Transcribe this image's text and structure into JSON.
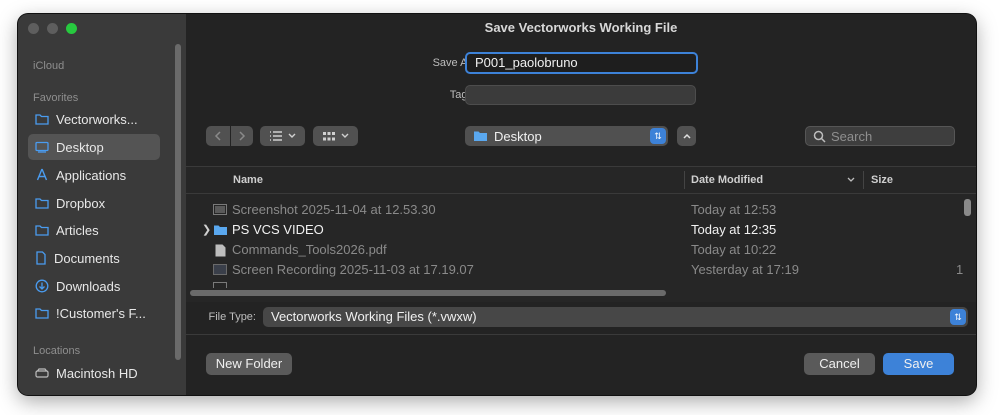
{
  "window": {
    "title": "Save Vectorworks Working File"
  },
  "sidebar": {
    "sections": [
      {
        "label": "iCloud"
      },
      {
        "label": "Favorites"
      },
      {
        "label": "Locations"
      }
    ],
    "items": [
      {
        "label": "Vectorworks...",
        "icon": "folder-icon"
      },
      {
        "label": "Desktop",
        "icon": "desktop-icon",
        "selected": true
      },
      {
        "label": "Applications",
        "icon": "applications-icon"
      },
      {
        "label": "Dropbox",
        "icon": "folder-icon"
      },
      {
        "label": "Articles",
        "icon": "folder-icon"
      },
      {
        "label": "Documents",
        "icon": "document-icon"
      },
      {
        "label": "Downloads",
        "icon": "downloads-icon"
      },
      {
        "label": "!Customer's F...",
        "icon": "folder-icon"
      }
    ],
    "locations": [
      {
        "label": "Macintosh HD",
        "icon": "drive-icon"
      }
    ]
  },
  "form": {
    "save_as_label": "Save As:",
    "save_as_value": "P001_paolobruno",
    "tags_label": "Tags:",
    "tags_value": ""
  },
  "toolbar": {
    "location": "Desktop",
    "search_placeholder": "Search"
  },
  "table": {
    "columns": {
      "name": "Name",
      "date": "Date Modified",
      "size": "Size"
    },
    "rows": [
      {
        "name": "Screenshot 2025-11-04 at 12.53.30",
        "date": "Today at 12:53",
        "size": "",
        "icon": "image-file-icon",
        "style": "dim"
      },
      {
        "name": "PS VCS VIDEO",
        "date": "Today at 12:35",
        "size": "",
        "icon": "folder-icon",
        "style": "bright",
        "folder": true
      },
      {
        "name": "Commands_Tools2026.pdf",
        "date": "Today at 10:22",
        "size": "",
        "icon": "pdf-file-icon",
        "style": "dim"
      },
      {
        "name": "Screen Recording 2025-11-03 at 17.19.07",
        "date": "Yesterday at 17:19",
        "size": "1",
        "icon": "video-file-icon",
        "style": "dim"
      }
    ]
  },
  "filetype": {
    "label": "File Type:",
    "value": "Vectorworks Working Files (*.vwxw)"
  },
  "buttons": {
    "new_folder": "New Folder",
    "cancel": "Cancel",
    "save": "Save"
  },
  "colors": {
    "accent": "#3d82d8",
    "sidebar": "#3a3a3a",
    "background": "#232323"
  }
}
